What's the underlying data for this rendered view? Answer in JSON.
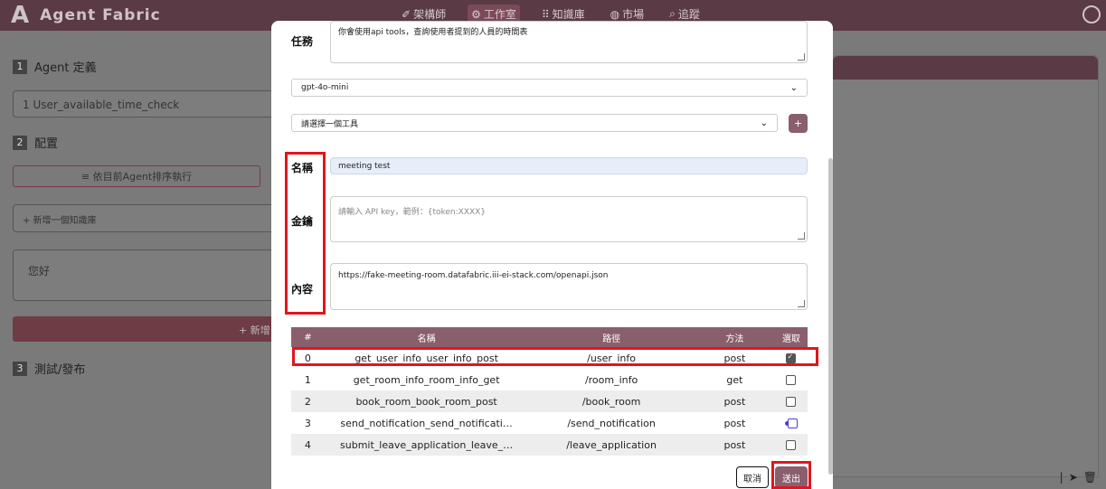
{
  "app": {
    "logo": "A",
    "title": "Agent Fabric"
  },
  "nav": [
    {
      "icon": "✐",
      "label": "架構師"
    },
    {
      "icon": "⚙",
      "label": "工作室"
    },
    {
      "icon": "⠿",
      "label": "知識庫"
    },
    {
      "icon": "◍",
      "label": "市場"
    },
    {
      "icon": "⌕",
      "label": "追蹤"
    }
  ],
  "background": {
    "step1_num": "1",
    "step1_label": "Agent 定義",
    "agent_name": "1  User_available_time_check",
    "step2_num": "2",
    "step2_label": "配置",
    "order_button": "≡ 依目前Agent排序執行",
    "add_kb": "+ 新增一個知識庫",
    "greeting": "您好",
    "add_partial": "+ 新增",
    "step3_num": "3",
    "step3_label": "測試/發布"
  },
  "modal": {
    "task_label": "任務",
    "task_value": "你會使用api tools，查詢使用者提到的人員的時間表",
    "model_select": "gpt-4o-mini",
    "tool_select": "請選擇一個工具",
    "plus_label": "+",
    "name_label": "名稱",
    "name_value": "meeting test",
    "key_label": "金鑰",
    "key_placeholder": "請輸入 API key，範例：{token:XXXX}",
    "content_label": "內容",
    "content_value": "https://fake-meeting-room.datafabric.iii-ei-stack.com/openapi.json",
    "table": {
      "headers": [
        "#",
        "名稱",
        "路徑",
        "方法",
        "選取"
      ],
      "rows": [
        {
          "idx": "0",
          "name": "get_user_info_user_info_post",
          "path": "/user_info",
          "method": "post",
          "selected": true
        },
        {
          "idx": "1",
          "name": "get_room_info_room_info_get",
          "path": "/room_info",
          "method": "get",
          "selected": false
        },
        {
          "idx": "2",
          "name": "book_room_book_room_post",
          "path": "/book_room",
          "method": "post",
          "selected": false
        },
        {
          "idx": "3",
          "name": "send_notification_send_notificati…",
          "path": "/send_notification",
          "method": "post",
          "selected": false
        },
        {
          "idx": "4",
          "name": "submit_leave_application_leave_…",
          "path": "/leave_application",
          "method": "post",
          "selected": false
        }
      ]
    },
    "cancel": "取消",
    "submit": "送出"
  }
}
